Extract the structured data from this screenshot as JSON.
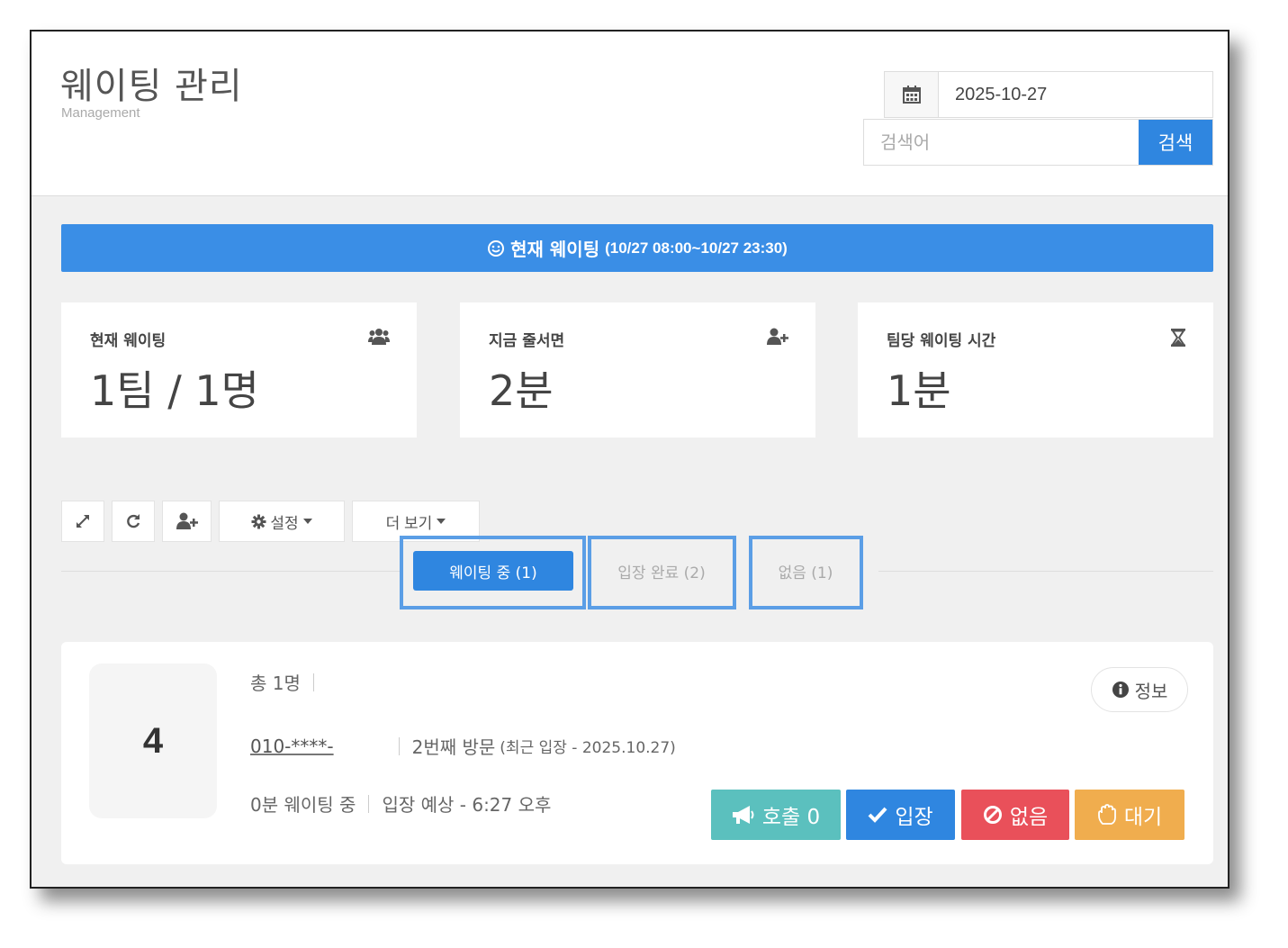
{
  "header": {
    "title": "웨이팅 관리",
    "subtitle": "Management",
    "date": "2025-10-27",
    "search_placeholder": "검색어",
    "search_button": "검색"
  },
  "banner": {
    "label": "현재 웨이팅",
    "range": "(10/27 08:00~10/27 23:30)"
  },
  "stats": [
    {
      "label": "현재 웨이팅",
      "value": "1팀 / 1명",
      "icon": "users-icon"
    },
    {
      "label": "지금 줄서면",
      "value": "2분",
      "icon": "user-plus-icon"
    },
    {
      "label": "팀당 웨이팅 시간",
      "value": "1분",
      "icon": "hourglass-icon"
    }
  ],
  "toolbar": {
    "settings_label": "설정",
    "more_label": "더 보기"
  },
  "tabs": [
    {
      "label": "웨이팅 중 (1)",
      "active": true
    },
    {
      "label": "입장 완료 (2)",
      "active": false
    },
    {
      "label": "없음 (1)",
      "active": false
    }
  ],
  "entry": {
    "number": "4",
    "total": "총 1명",
    "phone": "010-****-",
    "visit": "2번째 방문",
    "visit_detail": "(최근 입장 - 2025.10.27)",
    "waiting": "0분 웨이팅 중",
    "expected": "입장 예상 - 6:27 오후",
    "info_label": "정보",
    "actions": {
      "call": "호출 0",
      "enter": "입장",
      "none": "없음",
      "hold": "대기"
    }
  },
  "colors": {
    "primary": "#2f86e0",
    "call": "#5bc0be",
    "enter": "#2f86e0",
    "none": "#e9505a",
    "hold": "#f0ad4e"
  }
}
